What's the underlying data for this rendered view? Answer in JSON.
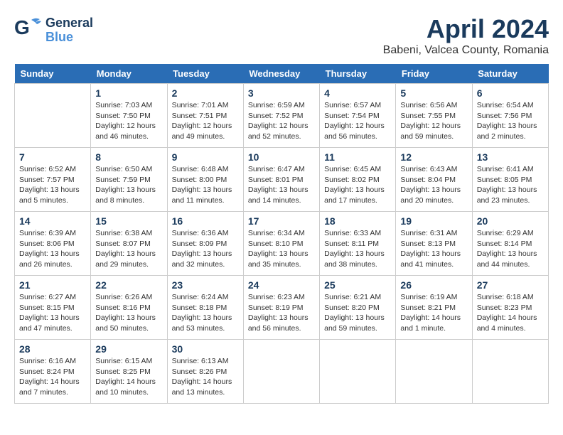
{
  "header": {
    "logo_general": "General",
    "logo_blue": "Blue",
    "month_title": "April 2024",
    "location": "Babeni, Valcea County, Romania"
  },
  "weekdays": [
    "Sunday",
    "Monday",
    "Tuesday",
    "Wednesday",
    "Thursday",
    "Friday",
    "Saturday"
  ],
  "weeks": [
    [
      {
        "day": "",
        "info": ""
      },
      {
        "day": "1",
        "info": "Sunrise: 7:03 AM\nSunset: 7:50 PM\nDaylight: 12 hours\nand 46 minutes."
      },
      {
        "day": "2",
        "info": "Sunrise: 7:01 AM\nSunset: 7:51 PM\nDaylight: 12 hours\nand 49 minutes."
      },
      {
        "day": "3",
        "info": "Sunrise: 6:59 AM\nSunset: 7:52 PM\nDaylight: 12 hours\nand 52 minutes."
      },
      {
        "day": "4",
        "info": "Sunrise: 6:57 AM\nSunset: 7:54 PM\nDaylight: 12 hours\nand 56 minutes."
      },
      {
        "day": "5",
        "info": "Sunrise: 6:56 AM\nSunset: 7:55 PM\nDaylight: 12 hours\nand 59 minutes."
      },
      {
        "day": "6",
        "info": "Sunrise: 6:54 AM\nSunset: 7:56 PM\nDaylight: 13 hours\nand 2 minutes."
      }
    ],
    [
      {
        "day": "7",
        "info": "Sunrise: 6:52 AM\nSunset: 7:57 PM\nDaylight: 13 hours\nand 5 minutes."
      },
      {
        "day": "8",
        "info": "Sunrise: 6:50 AM\nSunset: 7:59 PM\nDaylight: 13 hours\nand 8 minutes."
      },
      {
        "day": "9",
        "info": "Sunrise: 6:48 AM\nSunset: 8:00 PM\nDaylight: 13 hours\nand 11 minutes."
      },
      {
        "day": "10",
        "info": "Sunrise: 6:47 AM\nSunset: 8:01 PM\nDaylight: 13 hours\nand 14 minutes."
      },
      {
        "day": "11",
        "info": "Sunrise: 6:45 AM\nSunset: 8:02 PM\nDaylight: 13 hours\nand 17 minutes."
      },
      {
        "day": "12",
        "info": "Sunrise: 6:43 AM\nSunset: 8:04 PM\nDaylight: 13 hours\nand 20 minutes."
      },
      {
        "day": "13",
        "info": "Sunrise: 6:41 AM\nSunset: 8:05 PM\nDaylight: 13 hours\nand 23 minutes."
      }
    ],
    [
      {
        "day": "14",
        "info": "Sunrise: 6:39 AM\nSunset: 8:06 PM\nDaylight: 13 hours\nand 26 minutes."
      },
      {
        "day": "15",
        "info": "Sunrise: 6:38 AM\nSunset: 8:07 PM\nDaylight: 13 hours\nand 29 minutes."
      },
      {
        "day": "16",
        "info": "Sunrise: 6:36 AM\nSunset: 8:09 PM\nDaylight: 13 hours\nand 32 minutes."
      },
      {
        "day": "17",
        "info": "Sunrise: 6:34 AM\nSunset: 8:10 PM\nDaylight: 13 hours\nand 35 minutes."
      },
      {
        "day": "18",
        "info": "Sunrise: 6:33 AM\nSunset: 8:11 PM\nDaylight: 13 hours\nand 38 minutes."
      },
      {
        "day": "19",
        "info": "Sunrise: 6:31 AM\nSunset: 8:13 PM\nDaylight: 13 hours\nand 41 minutes."
      },
      {
        "day": "20",
        "info": "Sunrise: 6:29 AM\nSunset: 8:14 PM\nDaylight: 13 hours\nand 44 minutes."
      }
    ],
    [
      {
        "day": "21",
        "info": "Sunrise: 6:27 AM\nSunset: 8:15 PM\nDaylight: 13 hours\nand 47 minutes."
      },
      {
        "day": "22",
        "info": "Sunrise: 6:26 AM\nSunset: 8:16 PM\nDaylight: 13 hours\nand 50 minutes."
      },
      {
        "day": "23",
        "info": "Sunrise: 6:24 AM\nSunset: 8:18 PM\nDaylight: 13 hours\nand 53 minutes."
      },
      {
        "day": "24",
        "info": "Sunrise: 6:23 AM\nSunset: 8:19 PM\nDaylight: 13 hours\nand 56 minutes."
      },
      {
        "day": "25",
        "info": "Sunrise: 6:21 AM\nSunset: 8:20 PM\nDaylight: 13 hours\nand 59 minutes."
      },
      {
        "day": "26",
        "info": "Sunrise: 6:19 AM\nSunset: 8:21 PM\nDaylight: 14 hours\nand 1 minute."
      },
      {
        "day": "27",
        "info": "Sunrise: 6:18 AM\nSunset: 8:23 PM\nDaylight: 14 hours\nand 4 minutes."
      }
    ],
    [
      {
        "day": "28",
        "info": "Sunrise: 6:16 AM\nSunset: 8:24 PM\nDaylight: 14 hours\nand 7 minutes."
      },
      {
        "day": "29",
        "info": "Sunrise: 6:15 AM\nSunset: 8:25 PM\nDaylight: 14 hours\nand 10 minutes."
      },
      {
        "day": "30",
        "info": "Sunrise: 6:13 AM\nSunset: 8:26 PM\nDaylight: 14 hours\nand 13 minutes."
      },
      {
        "day": "",
        "info": ""
      },
      {
        "day": "",
        "info": ""
      },
      {
        "day": "",
        "info": ""
      },
      {
        "day": "",
        "info": ""
      }
    ]
  ]
}
